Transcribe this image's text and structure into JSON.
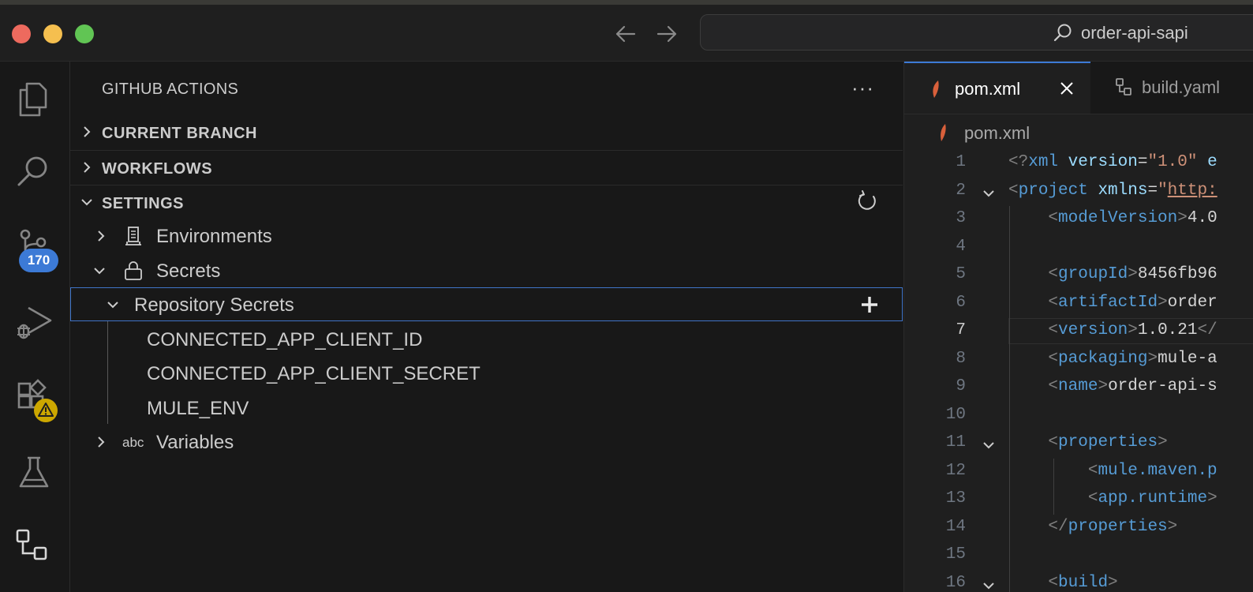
{
  "titlebar": {
    "command_center": "order-api-sapi"
  },
  "activity_bar": {
    "source_control_badge": "170"
  },
  "sidebar": {
    "title": "GITHUB ACTIONS",
    "more": "···",
    "sections": {
      "current_branch": "CURRENT BRANCH",
      "workflows": "WORKFLOWS",
      "settings": "SETTINGS"
    },
    "tree": {
      "environments": "Environments",
      "secrets": "Secrets",
      "repository_secrets": "Repository Secrets",
      "secret_items": [
        "CONNECTED_APP_CLIENT_ID",
        "CONNECTED_APP_CLIENT_SECRET",
        "MULE_ENV"
      ],
      "variables": "Variables",
      "variables_icon": "abc"
    }
  },
  "editor": {
    "tabs": [
      {
        "label": "pom.xml",
        "active": true
      },
      {
        "label": "build.yaml",
        "active": false
      }
    ],
    "breadcrumb": "pom.xml",
    "lines": [
      {
        "n": "1",
        "tokens": [
          [
            "punct",
            "<?"
          ],
          [
            "tag",
            "xml"
          ],
          [
            "text",
            " "
          ],
          [
            "attr",
            "version"
          ],
          [
            "text",
            "="
          ],
          [
            "str",
            "\"1.0\""
          ],
          [
            "text",
            " "
          ],
          [
            "attr",
            "e"
          ]
        ]
      },
      {
        "n": "2",
        "tokens": [
          [
            "punct",
            "<"
          ],
          [
            "tag",
            "project"
          ],
          [
            "text",
            " "
          ],
          [
            "attr",
            "xmlns"
          ],
          [
            "text",
            "="
          ],
          [
            "str",
            "\""
          ],
          [
            "link",
            "http:"
          ]
        ]
      },
      {
        "n": "3",
        "tokens": [
          [
            "text",
            "    "
          ],
          [
            "punct",
            "<"
          ],
          [
            "tag",
            "modelVersion"
          ],
          [
            "punct",
            ">"
          ],
          [
            "text",
            "4.0"
          ]
        ]
      },
      {
        "n": "4",
        "tokens": []
      },
      {
        "n": "5",
        "tokens": [
          [
            "text",
            "    "
          ],
          [
            "punct",
            "<"
          ],
          [
            "tag",
            "groupId"
          ],
          [
            "punct",
            ">"
          ],
          [
            "text",
            "8456fb96"
          ]
        ]
      },
      {
        "n": "6",
        "tokens": [
          [
            "text",
            "    "
          ],
          [
            "punct",
            "<"
          ],
          [
            "tag",
            "artifactId"
          ],
          [
            "punct",
            ">"
          ],
          [
            "text",
            "order"
          ]
        ]
      },
      {
        "n": "7",
        "tokens": [
          [
            "text",
            "    "
          ],
          [
            "punct",
            "<"
          ],
          [
            "tag",
            "version"
          ],
          [
            "punct",
            ">"
          ],
          [
            "text",
            "1.0.21"
          ],
          [
            "punct",
            "</"
          ]
        ]
      },
      {
        "n": "8",
        "tokens": [
          [
            "text",
            "    "
          ],
          [
            "punct",
            "<"
          ],
          [
            "tag",
            "packaging"
          ],
          [
            "punct",
            ">"
          ],
          [
            "text",
            "mule-a"
          ]
        ]
      },
      {
        "n": "9",
        "tokens": [
          [
            "text",
            "    "
          ],
          [
            "punct",
            "<"
          ],
          [
            "tag",
            "name"
          ],
          [
            "punct",
            ">"
          ],
          [
            "text",
            "order-api-s"
          ]
        ]
      },
      {
        "n": "10",
        "tokens": []
      },
      {
        "n": "11",
        "tokens": [
          [
            "text",
            "    "
          ],
          [
            "punct",
            "<"
          ],
          [
            "tag",
            "properties"
          ],
          [
            "punct",
            ">"
          ]
        ]
      },
      {
        "n": "12",
        "tokens": [
          [
            "text",
            "        "
          ],
          [
            "punct",
            "<"
          ],
          [
            "tag",
            "mule.maven.p"
          ]
        ]
      },
      {
        "n": "13",
        "tokens": [
          [
            "text",
            "        "
          ],
          [
            "punct",
            "<"
          ],
          [
            "tag",
            "app.runtime"
          ],
          [
            "punct",
            ">"
          ]
        ]
      },
      {
        "n": "14",
        "tokens": [
          [
            "text",
            "    "
          ],
          [
            "punct",
            "</"
          ],
          [
            "tag",
            "properties"
          ],
          [
            "punct",
            ">"
          ]
        ]
      },
      {
        "n": "15",
        "tokens": []
      },
      {
        "n": "16",
        "tokens": [
          [
            "text",
            "    "
          ],
          [
            "punct",
            "<"
          ],
          [
            "tag",
            "build"
          ],
          [
            "punct",
            ">"
          ]
        ]
      }
    ],
    "current_line": "7"
  }
}
